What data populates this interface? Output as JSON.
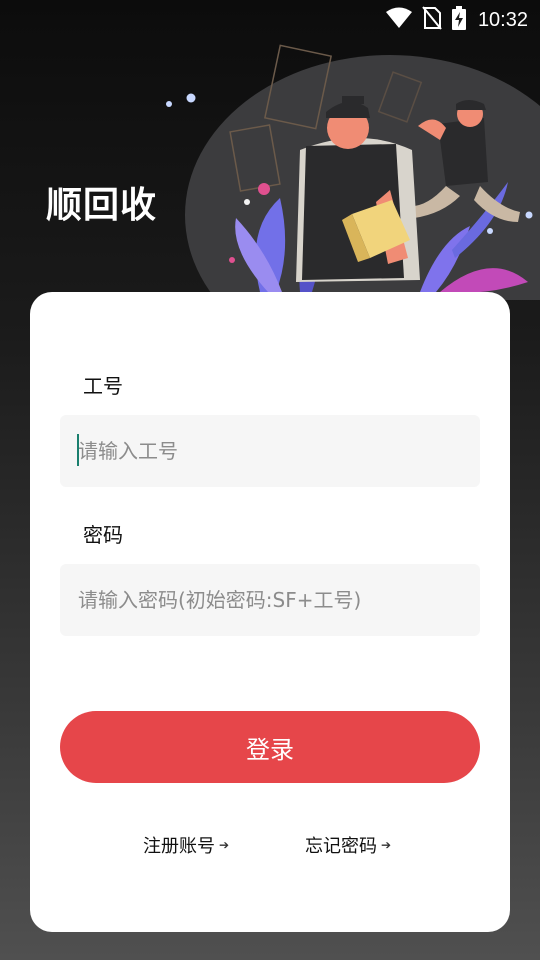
{
  "status_bar": {
    "time": "10:32",
    "icons": [
      "wifi-icon",
      "no-sim-icon",
      "battery-charging-icon"
    ]
  },
  "app": {
    "title": "顺回收"
  },
  "form": {
    "employee_id": {
      "label": "工号",
      "placeholder": "请输入工号",
      "value": ""
    },
    "password": {
      "label": "密码",
      "placeholder": "请输入密码(初始密码:SF+工号)",
      "value": ""
    },
    "login_label": "登录"
  },
  "links": {
    "register": "注册账号",
    "forgot_password": "忘记密码"
  },
  "colors": {
    "accent": "#e6464a",
    "input_bg": "#f6f6f6",
    "caret": "#1a7f6e"
  }
}
